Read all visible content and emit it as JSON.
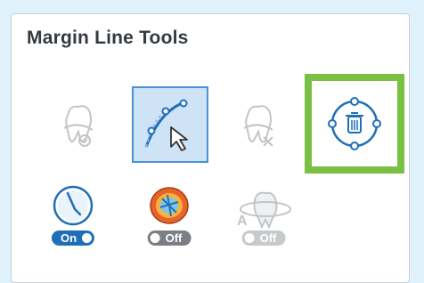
{
  "panel": {
    "title": "Margin Line Tools"
  },
  "tools": [
    {
      "name": "margin-line-edit",
      "state": "disabled"
    },
    {
      "name": "margin-line-draw",
      "state": "selected"
    },
    {
      "name": "margin-line-auto",
      "state": "disabled"
    },
    {
      "name": "margin-line-delete",
      "state": "highlighted"
    }
  ],
  "options": [
    {
      "name": "clip-view",
      "toggle_label": "On",
      "state": "on"
    },
    {
      "name": "color-map",
      "toggle_label": "Off",
      "state": "off"
    },
    {
      "name": "auto-rotate",
      "toggle_label": "Off",
      "state": "disabled"
    }
  ],
  "colors": {
    "accent": "#1f6fb8",
    "highlight": "#7ac043",
    "selected_bg": "#cfe3f7"
  }
}
